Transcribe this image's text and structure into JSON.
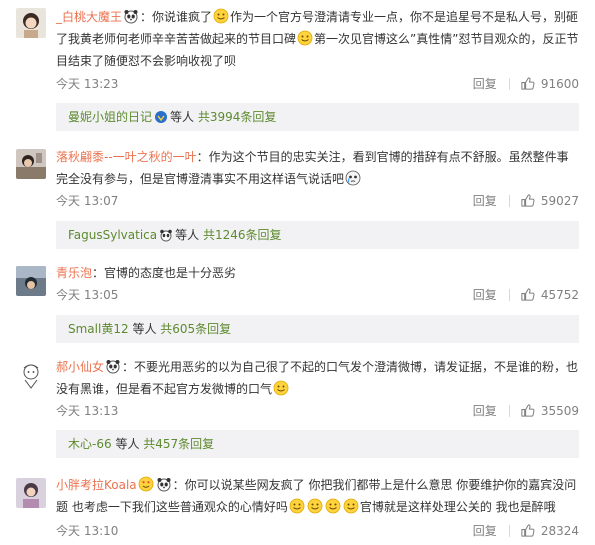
{
  "comments": [
    {
      "user": "_白桃大魔王",
      "text_a": "：你说谁疯了",
      "text_b": "作为一个官方号澄清请专业一点，你不是追星号不是私人号，别砸了我黄老师何老师辛辛苦苦做起来的节目口碑",
      "text_c": "第一次见官博这么”真性情”怼节目观众的，反正节目结束了随便怼不会影响收视了呗",
      "time": "今天 13:23",
      "reply_label": "回复",
      "likes": "91600",
      "thread_user": "曼妮小姐的日记",
      "thread_others": "等人",
      "thread_count": "共3994条回复"
    },
    {
      "user": "落秋翩黍--一叶之秋的一叶",
      "text_a": "：作为这个节目的忠实关注，看到官博的措辞有点不舒服。虽然整件事完全没有参与，但是官博澄清事实不用这样语气说话吧",
      "time": "今天 13:07",
      "reply_label": "回复",
      "likes": "59027",
      "thread_user": "FagusSylvatica",
      "thread_others": "等人",
      "thread_count": "共1246条回复"
    },
    {
      "user": "青乐泡",
      "text_a": "：官博的态度也是十分恶劣",
      "time": "今天 13:05",
      "reply_label": "回复",
      "likes": "45752",
      "thread_user": "Small黄12",
      "thread_others": "等人",
      "thread_count": "共605条回复"
    },
    {
      "user": "郝小仙女",
      "text_a": "：不要光用恶劣的以为自己很了不起的口气发个澄清微博，请发证据，不是谁的粉，也没有黑谁，但是看不起官方发微博的口气",
      "time": "今天 13:13",
      "reply_label": "回复",
      "likes": "35509",
      "thread_user": "木心-66",
      "thread_others": "等人",
      "thread_count": "共457条回复"
    },
    {
      "user": "小胖考拉Koala",
      "text_a": "：你可以说某些网友疯了 你把我们都带上是什么意思 你要维护你的嘉宾没问题 也考虑一下我们这些普通观众的心情好吗",
      "text_b": "官博就是这样处理公关的 我也是醉哦",
      "time": "今天 13:10",
      "reply_label": "回复",
      "likes": "28324"
    }
  ],
  "icons": {
    "like": "thumbs-up-icon",
    "emoji_smile": "smile-emoji-icon",
    "panda": "panda-emoji-icon",
    "vip": "vip-badge-icon"
  },
  "colors": {
    "username": "#eb7350",
    "thread_link": "#5d8a2e",
    "meta": "#808080",
    "thread_bg": "#f2f2f5"
  }
}
